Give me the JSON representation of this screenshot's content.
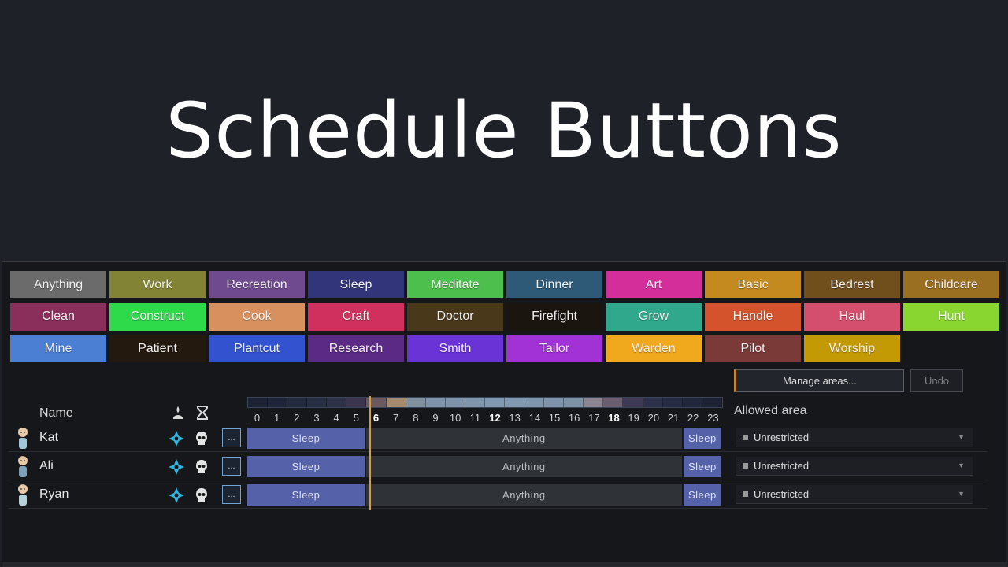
{
  "title": "Schedule Buttons",
  "schedule_buttons": [
    {
      "label": "Anything",
      "color": "#6b6b6b"
    },
    {
      "label": "Work",
      "color": "#838335"
    },
    {
      "label": "Recreation",
      "color": "#6f4a8f"
    },
    {
      "label": "Sleep",
      "color": "#33357a"
    },
    {
      "label": "Meditate",
      "color": "#4cbf4c"
    },
    {
      "label": "Dinner",
      "color": "#2e5a77"
    },
    {
      "label": "Art",
      "color": "#d32e9a"
    },
    {
      "label": "Basic",
      "color": "#c48a1f"
    },
    {
      "label": "Bedrest",
      "color": "#704f1d"
    },
    {
      "label": "Childcare",
      "color": "#9a6f22"
    },
    {
      "label": "Clean",
      "color": "#8a2f5c"
    },
    {
      "label": "Construct",
      "color": "#2ed94a"
    },
    {
      "label": "Cook",
      "color": "#d8915e"
    },
    {
      "label": "Craft",
      "color": "#d0305d"
    },
    {
      "label": "Doctor",
      "color": "#4a381a"
    },
    {
      "label": "Firefight",
      "color": "#1b150f"
    },
    {
      "label": "Grow",
      "color": "#2fa88c"
    },
    {
      "label": "Handle",
      "color": "#d4522c"
    },
    {
      "label": "Haul",
      "color": "#d44f6e"
    },
    {
      "label": "Hunt",
      "color": "#8ad631"
    },
    {
      "label": "Mine",
      "color": "#4b7fd3"
    },
    {
      "label": "Patient",
      "color": "#23190f"
    },
    {
      "label": "Plantcut",
      "color": "#3252d0"
    },
    {
      "label": "Research",
      "color": "#5a2a85"
    },
    {
      "label": "Smith",
      "color": "#6a33d6"
    },
    {
      "label": "Tailor",
      "color": "#a231d6"
    },
    {
      "label": "Warden",
      "color": "#f0a81d"
    },
    {
      "label": "Pilot",
      "color": "#7a3a38"
    },
    {
      "label": "Worship",
      "color": "#c49a04"
    }
  ],
  "controls": {
    "manage_areas": "Manage areas...",
    "undo": "Undo",
    "allowed_area": "Allowed area"
  },
  "header": {
    "name": "Name",
    "meditation_icon": "meditation-focus-icon",
    "timing_icon": "hourglass-icon"
  },
  "hours": [
    "0",
    "1",
    "2",
    "3",
    "4",
    "5",
    "6",
    "7",
    "8",
    "9",
    "10",
    "11",
    "12",
    "13",
    "14",
    "15",
    "16",
    "17",
    "18",
    "19",
    "20",
    "21",
    "22",
    "23"
  ],
  "bold_hours": [
    6,
    12,
    18
  ],
  "current_hour": 6,
  "hour_colors": [
    "#1c2233",
    "#1e2438",
    "#222a3e",
    "#262e44",
    "#2c3148",
    "#3c3550",
    "#6c5a5e",
    "#a58a6e",
    "#80909f",
    "#7f93aa",
    "#7f93aa",
    "#8096ac",
    "#8198b0",
    "#8198b0",
    "#8096ad",
    "#7f93aa",
    "#7f91a4",
    "#8a8590",
    "#6a5e70",
    "#3e3a55",
    "#2c3048",
    "#252b42",
    "#20273c",
    "#1c2233"
  ],
  "colonists": [
    {
      "name": "Kat",
      "avatar": "colonist-kat-avatar",
      "blocks": [
        {
          "label": "Sleep",
          "type": "sleep",
          "from": 0,
          "to": 6
        },
        {
          "label": "Anything",
          "type": "anything",
          "from": 6,
          "to": 22
        },
        {
          "label": "Sleep",
          "type": "sleep",
          "from": 22,
          "to": 24
        }
      ],
      "area": "Unrestricted"
    },
    {
      "name": "Ali",
      "avatar": "colonist-ali-avatar",
      "blocks": [
        {
          "label": "Sleep",
          "type": "sleep",
          "from": 0,
          "to": 6
        },
        {
          "label": "Anything",
          "type": "anything",
          "from": 6,
          "to": 22
        },
        {
          "label": "Sleep",
          "type": "sleep",
          "from": 22,
          "to": 24
        }
      ],
      "area": "Unrestricted"
    },
    {
      "name": "Ryan",
      "avatar": "colonist-ryan-avatar",
      "blocks": [
        {
          "label": "Sleep",
          "type": "sleep",
          "from": 0,
          "to": 6
        },
        {
          "label": "Anything",
          "type": "anything",
          "from": 6,
          "to": 22
        },
        {
          "label": "Sleep",
          "type": "sleep",
          "from": 22,
          "to": 24
        }
      ],
      "area": "Unrestricted"
    }
  ],
  "dots_label": "..."
}
